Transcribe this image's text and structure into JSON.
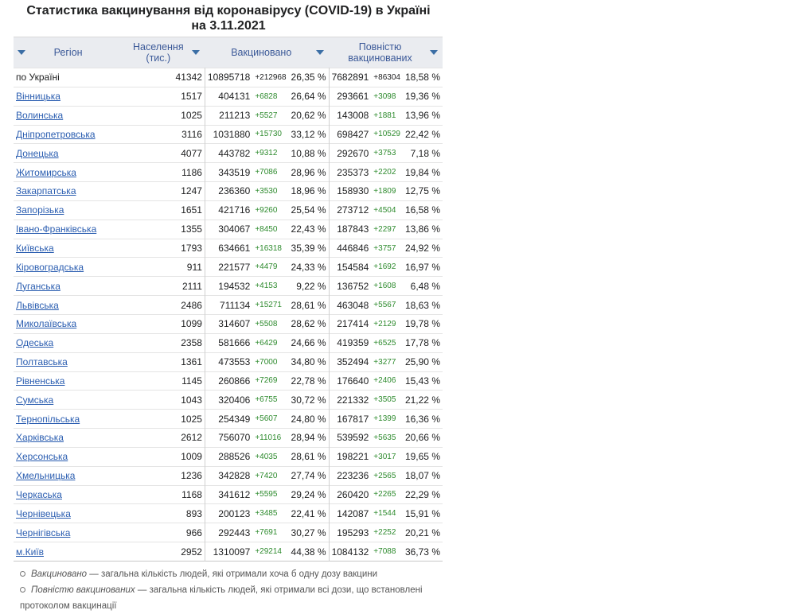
{
  "title_line1": "Статистика вакцинування від коронавірусу (COVID-19) в Україні",
  "title_line2": "на 3.11.2021",
  "headers": {
    "region": "Регіон",
    "population": "Населення (тис.)",
    "vaccinated": "Вакциновано",
    "fully": "Повністю вакцинованих"
  },
  "colors": {
    "link": "#2a5db0",
    "delta": "#2e8b2e",
    "header_bg": "#eaecf0"
  },
  "rows": [
    {
      "region": "по Україні",
      "pop": "41342",
      "vac": "10895718",
      "vac_delta": "+212968",
      "vac_pct": "26,35 %",
      "full": "7682891",
      "full_delta": "+86304",
      "full_pct": "18,58 %"
    },
    {
      "region": "Вінницька",
      "pop": "1517",
      "vac": "404131",
      "vac_delta": "+6828",
      "vac_pct": "26,64 %",
      "full": "293661",
      "full_delta": "+3098",
      "full_pct": "19,36 %"
    },
    {
      "region": "Волинська",
      "pop": "1025",
      "vac": "211213",
      "vac_delta": "+5527",
      "vac_pct": "20,62 %",
      "full": "143008",
      "full_delta": "+1881",
      "full_pct": "13,96 %"
    },
    {
      "region": "Дніпропетровська",
      "pop": "3116",
      "vac": "1031880",
      "vac_delta": "+15730",
      "vac_pct": "33,12 %",
      "full": "698427",
      "full_delta": "+10529",
      "full_pct": "22,42 %"
    },
    {
      "region": "Донецька",
      "pop": "4077",
      "vac": "443782",
      "vac_delta": "+9312",
      "vac_pct": "10,88 %",
      "full": "292670",
      "full_delta": "+3753",
      "full_pct": "7,18 %"
    },
    {
      "region": "Житомирська",
      "pop": "1186",
      "vac": "343519",
      "vac_delta": "+7086",
      "vac_pct": "28,96 %",
      "full": "235373",
      "full_delta": "+2202",
      "full_pct": "19,84 %"
    },
    {
      "region": "Закарпатська",
      "pop": "1247",
      "vac": "236360",
      "vac_delta": "+3530",
      "vac_pct": "18,96 %",
      "full": "158930",
      "full_delta": "+1809",
      "full_pct": "12,75 %"
    },
    {
      "region": "Запорізька",
      "pop": "1651",
      "vac": "421716",
      "vac_delta": "+9260",
      "vac_pct": "25,54 %",
      "full": "273712",
      "full_delta": "+4504",
      "full_pct": "16,58 %"
    },
    {
      "region": "Івано-Франківська",
      "pop": "1355",
      "vac": "304067",
      "vac_delta": "+8450",
      "vac_pct": "22,43 %",
      "full": "187843",
      "full_delta": "+2297",
      "full_pct": "13,86 %"
    },
    {
      "region": "Київська",
      "pop": "1793",
      "vac": "634661",
      "vac_delta": "+16318",
      "vac_pct": "35,39 %",
      "full": "446846",
      "full_delta": "+3757",
      "full_pct": "24,92 %"
    },
    {
      "region": "Кіровоградська",
      "pop": "911",
      "vac": "221577",
      "vac_delta": "+4479",
      "vac_pct": "24,33 %",
      "full": "154584",
      "full_delta": "+1692",
      "full_pct": "16,97 %"
    },
    {
      "region": "Луганська",
      "pop": "2111",
      "vac": "194532",
      "vac_delta": "+4153",
      "vac_pct": "9,22 %",
      "full": "136752",
      "full_delta": "+1608",
      "full_pct": "6,48 %"
    },
    {
      "region": "Львівська",
      "pop": "2486",
      "vac": "711134",
      "vac_delta": "+15271",
      "vac_pct": "28,61 %",
      "full": "463048",
      "full_delta": "+5567",
      "full_pct": "18,63 %"
    },
    {
      "region": "Миколаївська",
      "pop": "1099",
      "vac": "314607",
      "vac_delta": "+5508",
      "vac_pct": "28,62 %",
      "full": "217414",
      "full_delta": "+2129",
      "full_pct": "19,78 %"
    },
    {
      "region": "Одеська",
      "pop": "2358",
      "vac": "581666",
      "vac_delta": "+6429",
      "vac_pct": "24,66 %",
      "full": "419359",
      "full_delta": "+6525",
      "full_pct": "17,78 %"
    },
    {
      "region": "Полтавська",
      "pop": "1361",
      "vac": "473553",
      "vac_delta": "+7000",
      "vac_pct": "34,80 %",
      "full": "352494",
      "full_delta": "+3277",
      "full_pct": "25,90 %"
    },
    {
      "region": "Рівненська",
      "pop": "1145",
      "vac": "260866",
      "vac_delta": "+7269",
      "vac_pct": "22,78 %",
      "full": "176640",
      "full_delta": "+2406",
      "full_pct": "15,43 %"
    },
    {
      "region": "Сумська",
      "pop": "1043",
      "vac": "320406",
      "vac_delta": "+6755",
      "vac_pct": "30,72 %",
      "full": "221332",
      "full_delta": "+3505",
      "full_pct": "21,22 %"
    },
    {
      "region": "Тернопільська",
      "pop": "1025",
      "vac": "254349",
      "vac_delta": "+5607",
      "vac_pct": "24,80 %",
      "full": "167817",
      "full_delta": "+1399",
      "full_pct": "16,36 %"
    },
    {
      "region": "Харківська",
      "pop": "2612",
      "vac": "756070",
      "vac_delta": "+11016",
      "vac_pct": "28,94 %",
      "full": "539592",
      "full_delta": "+5635",
      "full_pct": "20,66 %"
    },
    {
      "region": "Херсонська",
      "pop": "1009",
      "vac": "288526",
      "vac_delta": "+4035",
      "vac_pct": "28,61 %",
      "full": "198221",
      "full_delta": "+3017",
      "full_pct": "19,65 %"
    },
    {
      "region": "Хмельницька",
      "pop": "1236",
      "vac": "342828",
      "vac_delta": "+7420",
      "vac_pct": "27,74 %",
      "full": "223236",
      "full_delta": "+2565",
      "full_pct": "18,07 %"
    },
    {
      "region": "Черкаська",
      "pop": "1168",
      "vac": "341612",
      "vac_delta": "+5595",
      "vac_pct": "29,24 %",
      "full": "260420",
      "full_delta": "+2265",
      "full_pct": "22,29 %"
    },
    {
      "region": "Чернівецька",
      "pop": "893",
      "vac": "200123",
      "vac_delta": "+3485",
      "vac_pct": "22,41 %",
      "full": "142087",
      "full_delta": "+1544",
      "full_pct": "15,91 %"
    },
    {
      "region": "Чернігівська",
      "pop": "966",
      "vac": "292443",
      "vac_delta": "+7691",
      "vac_pct": "30,27 %",
      "full": "195293",
      "full_delta": "+2252",
      "full_pct": "20,21 %"
    },
    {
      "region": "м.Київ",
      "pop": "2952",
      "vac": "1310097",
      "vac_delta": "+29214",
      "vac_pct": "44,38 %",
      "full": "1084132",
      "full_delta": "+7088",
      "full_pct": "36,73 %"
    }
  ],
  "notes": [
    {
      "term": "Вакциновано",
      "text": " — загальна кількість людей, які отримали хоча б одну дозу вакцини"
    },
    {
      "term": "Повністю вакцинованих",
      "text": " — загальна кількість людей, які отримали всі дози, що встановлені протоколом вакцинації"
    }
  ]
}
